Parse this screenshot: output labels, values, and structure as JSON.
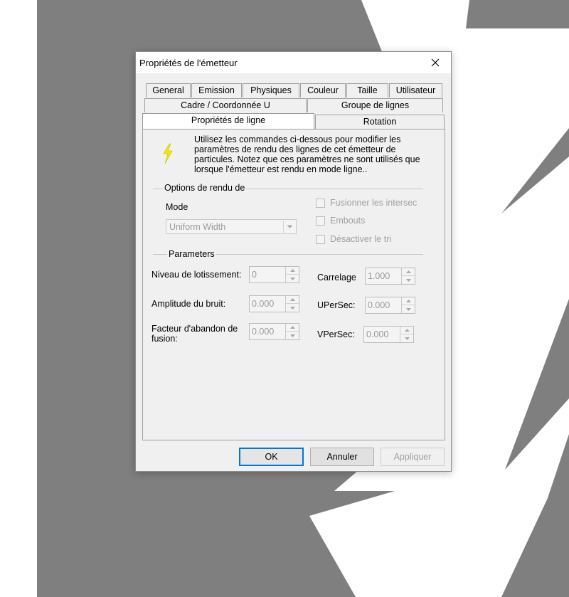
{
  "window": {
    "title": "Propriétés de l'émetteur"
  },
  "tabs": {
    "row1": [
      "General",
      "Emission",
      "Physiques",
      "Couleur",
      "Taille",
      "Utilisateur"
    ],
    "row2": [
      "Cadre / Coordonnée U",
      "Groupe de lignes"
    ],
    "row3": [
      "Propriétés de ligne",
      "Rotation"
    ],
    "active": "Propriétés de ligne"
  },
  "info": {
    "text": "Utilisez les commandes ci-dessous pour modifier les paramètres de rendu des lignes de cet émetteur de particules. Notez que ces paramètres ne sont utilisés que lorsque l'émetteur est rendu en mode ligne..",
    "icon": "lightning-bolt-icon",
    "icon_color": "#f5e800"
  },
  "render_options": {
    "group_label": "Options de rendu de",
    "mode_label": "Mode",
    "mode_value": "Uniform Width",
    "checkboxes": [
      "Fusionner les intersec",
      "Embouts",
      "Désactiver le tri"
    ]
  },
  "parameters": {
    "group_label": "Parameters",
    "batch_level": {
      "label": "Niveau de lotissement:",
      "value": "0"
    },
    "noise_amplitude": {
      "label": "Amplitude du bruit:",
      "value": "0.000"
    },
    "merge_drop": {
      "label": "Facteur d'abandon de fusion:",
      "value": "0.000"
    },
    "tiling": {
      "label": "Carrelage",
      "value": "1.000"
    },
    "u_per_sec": {
      "label": "UPerSec:",
      "value": "0.000"
    },
    "v_per_sec": {
      "label": "VPerSec:",
      "value": "0.000"
    }
  },
  "buttons": {
    "ok": "OK",
    "cancel": "Annuler",
    "apply": "Appliquer"
  }
}
